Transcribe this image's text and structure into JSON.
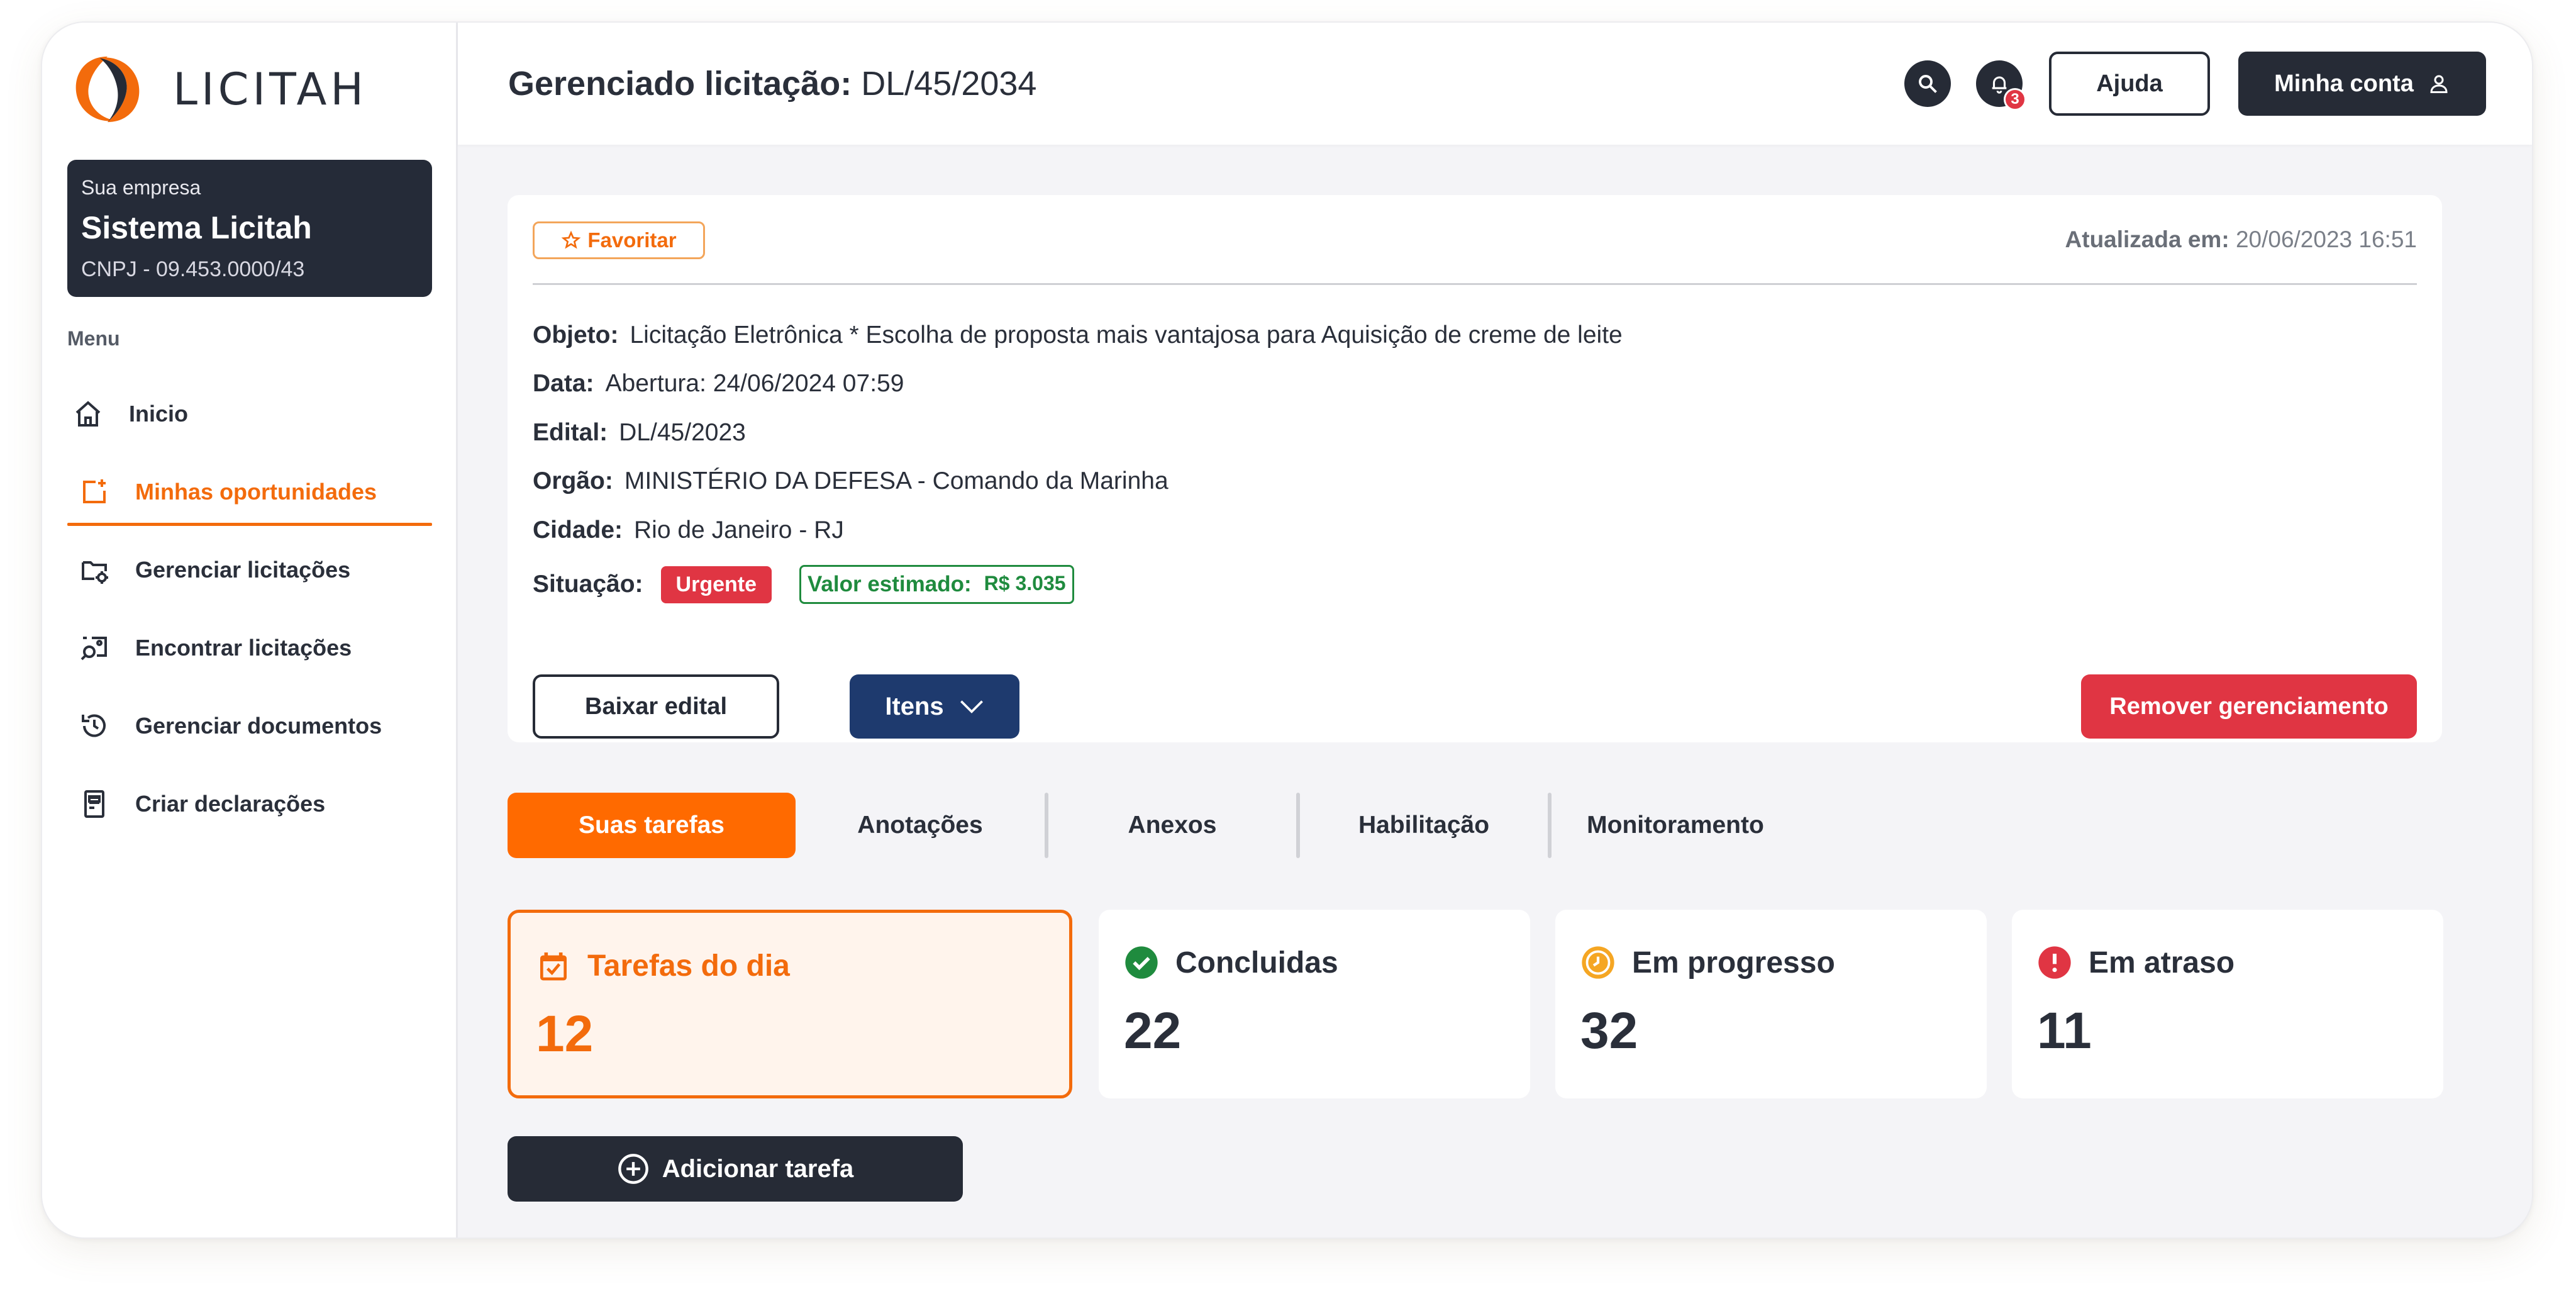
{
  "brand": {
    "name": "LICITAH",
    "accent": "#f36b0c"
  },
  "company": {
    "label": "Sua empresa",
    "name": "Sistema Licitah",
    "cnpj": "CNPJ - 09.453.0000/43"
  },
  "menu": {
    "label": "Menu",
    "items": [
      {
        "label": "Inicio",
        "icon": "home-icon"
      },
      {
        "label": "Minhas oportunidades",
        "icon": "add-document-icon",
        "active": true
      },
      {
        "label": "Gerenciar licitações",
        "icon": "folder-settings-icon"
      },
      {
        "label": "Encontrar licitações",
        "icon": "image-search-icon"
      },
      {
        "label": "Gerenciar documentos",
        "icon": "history-icon"
      },
      {
        "label": "Criar declarações",
        "icon": "document-icon"
      }
    ]
  },
  "header": {
    "title_label": "Gerenciado licitação:",
    "title_code": "DL/45/2034",
    "notifications_count": "3",
    "help_label": "Ajuda",
    "account_label": "Minha conta"
  },
  "detail": {
    "favorite_label": "Favoritar",
    "updated_label": "Atualizada em:",
    "updated_value": "20/06/2023 16:51",
    "fields": [
      {
        "label": "Objeto:",
        "value": "Licitação Eletrônica * Escolha de proposta mais vantajosa para Aquisição de creme de leite"
      },
      {
        "label": "Data:",
        "value": "Abertura: 24/06/2024 07:59"
      },
      {
        "label": "Edital:",
        "value": "DL/45/2023"
      },
      {
        "label": "Orgão:",
        "value": "MINISTÉRIO DA DEFESA - Comando da Marinha"
      },
      {
        "label": "Cidade:",
        "value": "Rio de Janeiro - RJ"
      }
    ],
    "situation_label": "Situação:",
    "situation_value": "Urgente",
    "estimated_label": "Valor estimado:",
    "estimated_value": "R$ 3.035",
    "download_label": "Baixar edital",
    "items_label": "Itens",
    "remove_label": "Remover gerenciamento"
  },
  "tabs": [
    "Suas tarefas",
    "Anotações",
    "Anexos",
    "Habilitação",
    "Monitoramento"
  ],
  "stats": [
    {
      "title": "Tarefas do dia",
      "value": "12",
      "icon": "calendar-check-icon",
      "color": "#f36b0c"
    },
    {
      "title": "Concluidas",
      "value": "22",
      "icon": "check-circle-icon",
      "color": "#1f8b3e"
    },
    {
      "title": "Em progresso",
      "value": "32",
      "icon": "clock-icon",
      "color": "#f5a623"
    },
    {
      "title": "Em atraso",
      "value": "11",
      "icon": "alert-icon",
      "color": "#e03543"
    }
  ],
  "add_task_label": "Adicionar tarefa"
}
